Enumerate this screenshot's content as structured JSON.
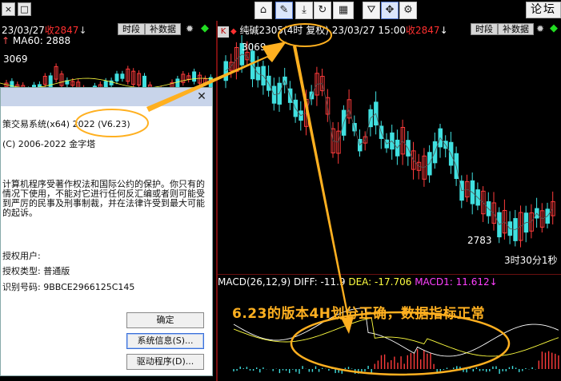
{
  "topbar": {
    "window_buttons": [
      "×",
      "□"
    ],
    "toolbar_icons": [
      {
        "name": "home-icon",
        "glyph": "⌂"
      },
      {
        "name": "ruler-icon",
        "glyph": "✎"
      },
      {
        "name": "download-icon",
        "glyph": "⤓"
      },
      {
        "name": "refresh-icon",
        "glyph": "↻"
      },
      {
        "name": "grid-icon",
        "glyph": "▦"
      },
      {
        "name": "filter-icon",
        "glyph": "⛛"
      },
      {
        "name": "move-icon",
        "glyph": "✥"
      },
      {
        "name": "settings-icon",
        "glyph": "⚙"
      }
    ],
    "forum_label": "论坛"
  },
  "left_chart": {
    "date": "23/03/27",
    "close_label": "收2847",
    "arrow": "↓",
    "timeframe_btn": "时段",
    "supplement_btn": "补数据",
    "ma_text": "MA60: 2888",
    "high_label": "3069"
  },
  "right_chart": {
    "k_label": "K",
    "symbol": "纯碱2305(4时 复权)",
    "datetime": "23/03/27 15:00",
    "close_label": "收2847",
    "arrow": "↓",
    "timeframe_btn": "时段",
    "supplement_btn": "补数据",
    "high_label": "3069",
    "low_label": "2783",
    "countdown": "3时30分1秒",
    "macd": {
      "params": "MACD(26,12,9)",
      "diff": "DIFF: -11.9",
      "dea": "DEA: -17.706",
      "macd1": "MACD1: 11.612",
      "arrow": "↓"
    }
  },
  "dialog": {
    "product": "策交易系统(x64) 2022 (V6.23)",
    "copyright": "(C) 2006-2022 金字塔",
    "description": "计算机程序受著作权法和国际公约的保护。你只有的情况下使用，不能对它进行任何反汇编或者则可能受到严厉的民事及刑事制裁，并在法律许受到最大可能的起诉。",
    "licensed_user": "授权用户:",
    "license_type": "授权类型: 普通版",
    "serial": "识别号码: 9BBCE2966125C145",
    "ok_btn": "确定",
    "sysinfo_btn": "系统信息(S)...",
    "driver_btn": "驱动程序(D)..."
  },
  "annotation": {
    "text": "6.23的版本4H划分正确，数据指标正常",
    "color": "#ffb020"
  }
}
